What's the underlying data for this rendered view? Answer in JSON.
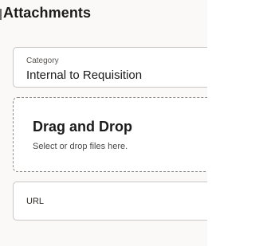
{
  "section": {
    "title": "Attachments"
  },
  "category": {
    "label": "Category",
    "value": "Internal to Requisition"
  },
  "dropzone": {
    "title": "Drag and Drop",
    "hint": "Select or drop files here."
  },
  "url": {
    "label": "URL"
  }
}
